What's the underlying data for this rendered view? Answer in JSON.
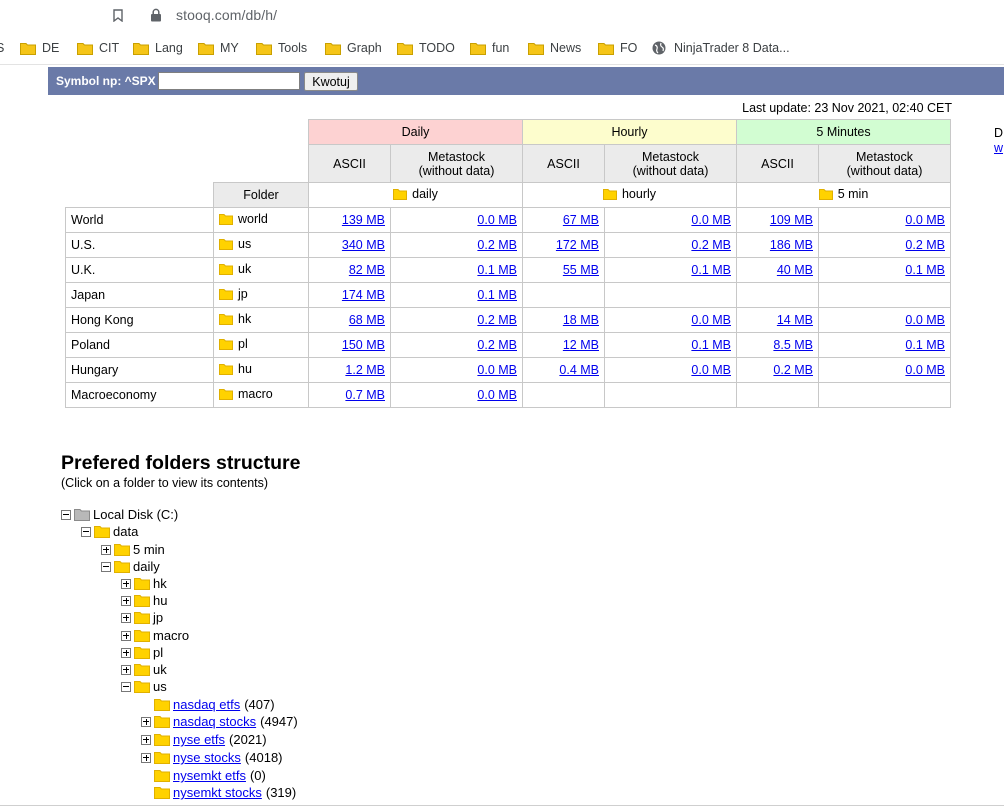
{
  "browser": {
    "url": "stooq.com/db/h/",
    "bookmarks": [
      {
        "label": "S",
        "type": "partial"
      },
      {
        "label": "DE",
        "type": "folder"
      },
      {
        "label": "CIT",
        "type": "folder"
      },
      {
        "label": "Lang",
        "type": "folder"
      },
      {
        "label": "MY",
        "type": "folder"
      },
      {
        "label": "Tools",
        "type": "folder"
      },
      {
        "label": "Graph",
        "type": "folder"
      },
      {
        "label": "TODO",
        "type": "folder"
      },
      {
        "label": "fun",
        "type": "folder"
      },
      {
        "label": "News",
        "type": "folder"
      },
      {
        "label": "FO",
        "type": "folder"
      },
      {
        "label": "NinjaTrader 8 Data...",
        "type": "globe"
      }
    ]
  },
  "symbol_bar": {
    "label": "Symbol np: ^SPX",
    "input_value": "",
    "button_label": "Kwotuj",
    "color": "#6a7aa8"
  },
  "last_update": "Last update: 23 Nov 2021, 02:40 CET",
  "table": {
    "groups": [
      "Daily",
      "Hourly",
      "5 Minutes"
    ],
    "group_colors": [
      "#fdd2d2",
      "#fdfdcd",
      "#d2fdd2"
    ],
    "sub_ascii": "ASCII",
    "sub_meta_line1": "Metastock",
    "sub_meta_line2": "(without data)",
    "folder_header": "Folder",
    "group_folders": [
      "daily",
      "hourly",
      "5 min"
    ],
    "rows": [
      {
        "market": "World",
        "folder": "world",
        "cells": [
          "139 MB",
          "0.0 MB",
          "67 MB",
          "0.0 MB",
          "109 MB",
          "0.0 MB"
        ]
      },
      {
        "market": "U.S.",
        "folder": "us",
        "cells": [
          "340 MB",
          "0.2 MB",
          "172 MB",
          "0.2 MB",
          "186 MB",
          "0.2 MB"
        ]
      },
      {
        "market": "U.K.",
        "folder": "uk",
        "cells": [
          "82 MB",
          "0.1 MB",
          "55 MB",
          "0.1 MB",
          "40 MB",
          "0.1 MB"
        ]
      },
      {
        "market": "Japan",
        "folder": "jp",
        "cells": [
          "174 MB",
          "0.1 MB",
          "",
          "",
          "",
          ""
        ]
      },
      {
        "market": "Hong Kong",
        "folder": "hk",
        "cells": [
          "68 MB",
          "0.2 MB",
          "18 MB",
          "0.0 MB",
          "14 MB",
          "0.0 MB"
        ]
      },
      {
        "market": "Poland",
        "folder": "pl",
        "cells": [
          "150 MB",
          "0.2 MB",
          "12 MB",
          "0.1 MB",
          "8.5 MB",
          "0.1 MB"
        ]
      },
      {
        "market": "Hungary",
        "folder": "hu",
        "cells": [
          "1.2 MB",
          "0.0 MB",
          "0.4 MB",
          "0.0 MB",
          "0.2 MB",
          "0.0 MB"
        ]
      },
      {
        "market": "Macroeconomy",
        "folder": "macro",
        "cells": [
          "0.7 MB",
          "0.0 MB",
          "",
          "",
          "",
          ""
        ]
      }
    ]
  },
  "right_clip": {
    "line1": "D",
    "line2": "w"
  },
  "tree": {
    "title": "Prefered folders structure",
    "subtitle": "(Click on a folder to view its contents)",
    "nodes": [
      {
        "label": "Local Disk (C:)",
        "toggle": "minus",
        "icon": "drive",
        "link": false,
        "count": ""
      },
      {
        "label": "data",
        "toggle": "minus",
        "icon": "folder",
        "link": false,
        "count": ""
      },
      {
        "label": "5 min",
        "toggle": "plus",
        "icon": "folder",
        "link": false,
        "count": ""
      },
      {
        "label": "daily",
        "toggle": "minus",
        "icon": "folder",
        "link": false,
        "count": ""
      },
      {
        "label": "hk",
        "toggle": "plus",
        "icon": "folder",
        "link": false,
        "count": ""
      },
      {
        "label": "hu",
        "toggle": "plus",
        "icon": "folder",
        "link": false,
        "count": ""
      },
      {
        "label": "jp",
        "toggle": "plus",
        "icon": "folder",
        "link": false,
        "count": ""
      },
      {
        "label": "macro",
        "toggle": "plus",
        "icon": "folder",
        "link": false,
        "count": ""
      },
      {
        "label": "pl",
        "toggle": "plus",
        "icon": "folder",
        "link": false,
        "count": ""
      },
      {
        "label": "uk",
        "toggle": "plus",
        "icon": "folder",
        "link": false,
        "count": ""
      },
      {
        "label": "us",
        "toggle": "minus",
        "icon": "folder",
        "link": false,
        "count": ""
      },
      {
        "label": "nasdaq etfs",
        "toggle": "none",
        "icon": "folder",
        "link": true,
        "count": "(407)"
      },
      {
        "label": "nasdaq stocks",
        "toggle": "plus",
        "icon": "folder",
        "link": true,
        "count": "(4947)"
      },
      {
        "label": "nyse etfs",
        "toggle": "plus",
        "icon": "folder",
        "link": true,
        "count": "(2021)"
      },
      {
        "label": "nyse stocks",
        "toggle": "plus",
        "icon": "folder",
        "link": true,
        "count": "(4018)"
      },
      {
        "label": "nysemkt etfs",
        "toggle": "none",
        "icon": "folder",
        "link": true,
        "count": "(0)"
      },
      {
        "label": "nysemkt stocks",
        "toggle": "none",
        "icon": "folder",
        "link": true,
        "count": "(319)"
      }
    ]
  }
}
